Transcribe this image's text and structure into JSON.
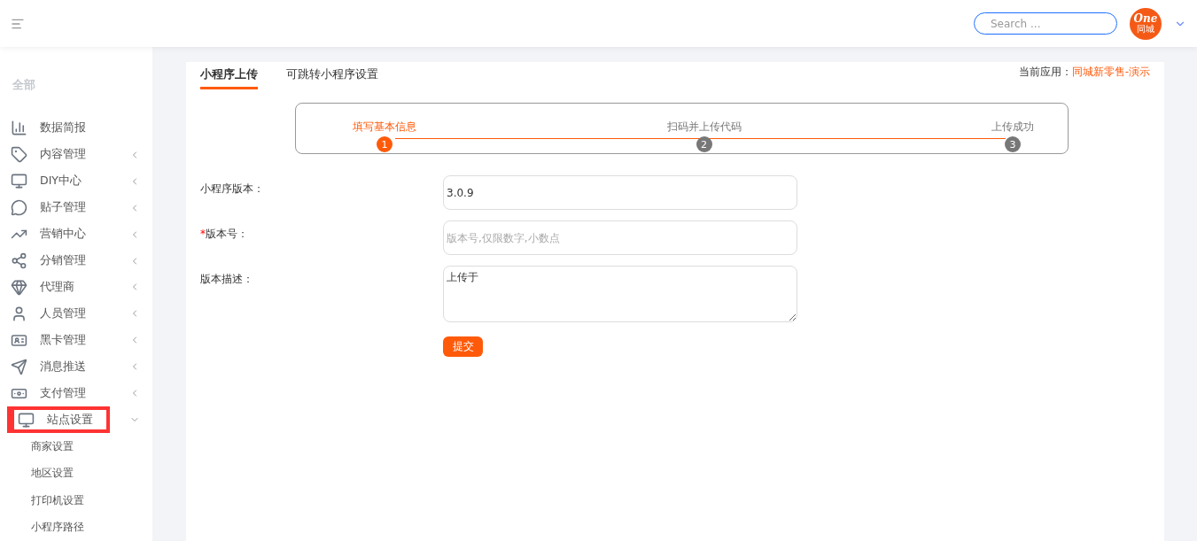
{
  "header": {
    "search": {
      "placeholder": "Search ..."
    },
    "logo": {
      "text": "One",
      "subtext": "同城"
    }
  },
  "sidebar": {
    "section": "全部",
    "items": [
      {
        "label": "数据简报",
        "has_arrow": false,
        "expanded": false,
        "highlighted": false
      },
      {
        "label": "内容管理",
        "has_arrow": true,
        "expanded": false,
        "highlighted": false
      },
      {
        "label": "DIY中心",
        "has_arrow": true,
        "expanded": false,
        "highlighted": false
      },
      {
        "label": "贴子管理",
        "has_arrow": true,
        "expanded": false,
        "highlighted": false
      },
      {
        "label": "营销中心",
        "has_arrow": true,
        "expanded": false,
        "highlighted": false
      },
      {
        "label": "分销管理",
        "has_arrow": true,
        "expanded": false,
        "highlighted": false
      },
      {
        "label": "代理商",
        "has_arrow": true,
        "expanded": false,
        "highlighted": false
      },
      {
        "label": "人员管理",
        "has_arrow": true,
        "expanded": false,
        "highlighted": false
      },
      {
        "label": "黑卡管理",
        "has_arrow": true,
        "expanded": false,
        "highlighted": false
      },
      {
        "label": "消息推送",
        "has_arrow": true,
        "expanded": false,
        "highlighted": false
      },
      {
        "label": "支付管理",
        "has_arrow": true,
        "expanded": false,
        "highlighted": false
      },
      {
        "label": "站点设置",
        "has_arrow": true,
        "expanded": true,
        "highlighted": true,
        "children": [
          {
            "label": "商家设置"
          },
          {
            "label": "地区设置"
          },
          {
            "label": "打印机设置"
          },
          {
            "label": "小程序路径"
          }
        ]
      }
    ]
  },
  "tabs": [
    {
      "label": "小程序上传",
      "selected": true
    },
    {
      "label": "可跳转小程序设置",
      "selected": false
    }
  ],
  "current_app": {
    "label": "当前应用：",
    "value": "同城新零售-演示"
  },
  "steps": [
    {
      "number": "1",
      "label": "填写基本信息",
      "active": true
    },
    {
      "number": "2",
      "label": "扫码并上传代码",
      "active": false
    },
    {
      "number": "3",
      "label": "上传成功",
      "active": false
    }
  ],
  "form": {
    "fields": [
      {
        "kind": "input",
        "label": "小程序版本：",
        "required": false,
        "value": "3.0.9"
      },
      {
        "kind": "input",
        "label": "版本号：",
        "required": true,
        "placeholder": "版本号,仅限数字,小数点"
      },
      {
        "kind": "textarea",
        "label": "版本描述：",
        "required": false,
        "value": "上传于"
      }
    ],
    "required_mark": "*",
    "submit": "提交"
  }
}
